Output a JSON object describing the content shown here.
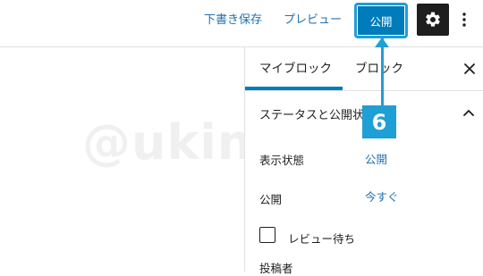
{
  "header": {
    "save_draft_label": "下書き保存",
    "preview_label": "プレビュー",
    "publish_label": "公開"
  },
  "watermark": "@ukinam",
  "sidebar": {
    "tabs": [
      {
        "label": "マイブロック",
        "active": true
      },
      {
        "label": "ブロック",
        "active": false
      }
    ],
    "panel": {
      "title": "ステータスと公開状態",
      "rows": [
        {
          "label": "表示状態",
          "value": "公開"
        },
        {
          "label": "公開",
          "value": "今すぐ"
        }
      ],
      "pending_review_label": "レビュー待ち",
      "pending_review_checked": false,
      "author_label": "投稿者"
    }
  },
  "callout": {
    "number": "6"
  },
  "colors": {
    "accent": "#007cba",
    "link": "#2271b1",
    "callout": "#1e9fd6",
    "dark": "#1e1e1e"
  }
}
